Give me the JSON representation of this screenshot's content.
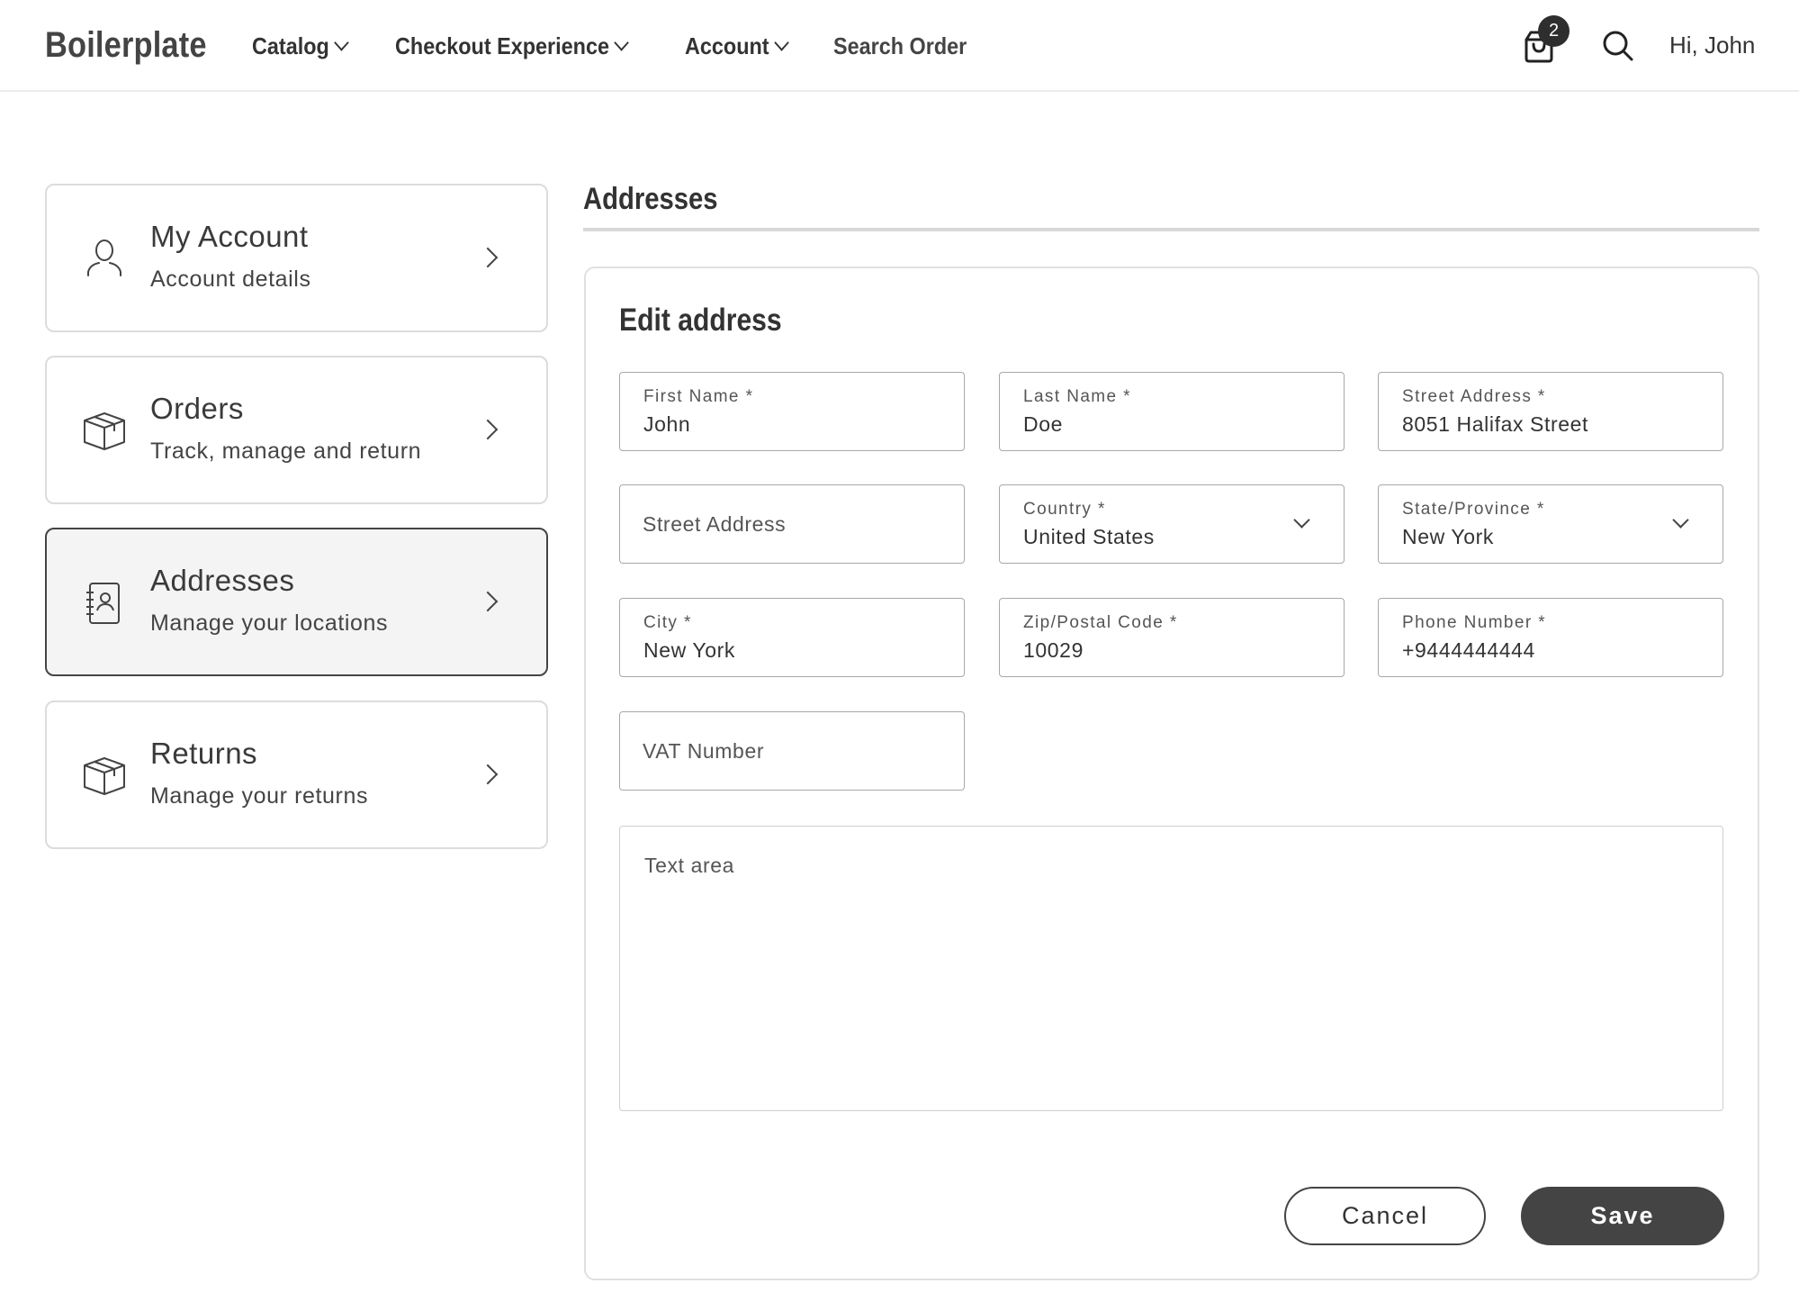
{
  "header": {
    "logo": "Boilerplate",
    "nav": [
      {
        "label": "Catalog",
        "has_dropdown": true
      },
      {
        "label": "Checkout Experience",
        "has_dropdown": true
      },
      {
        "label": "Account",
        "has_dropdown": true
      },
      {
        "label": "Search Order",
        "has_dropdown": false
      }
    ],
    "cart_icon": "shopping-bag-icon",
    "cart_count": "2",
    "search_icon": "search-icon",
    "greeting": "Hi, John"
  },
  "sidebar": {
    "items": [
      {
        "title": "My Account",
        "subtitle": "Account details",
        "icon": "user-icon",
        "active": false
      },
      {
        "title": "Orders",
        "subtitle": "Track, manage and return",
        "icon": "box-icon",
        "active": false
      },
      {
        "title": "Addresses",
        "subtitle": "Manage your locations",
        "icon": "address-book-icon",
        "active": true
      },
      {
        "title": "Returns",
        "subtitle": "Manage your returns",
        "icon": "box-icon",
        "active": false
      }
    ]
  },
  "main": {
    "page_title": "Addresses",
    "form": {
      "title": "Edit address",
      "fields": {
        "first_name": {
          "label": "First Name *",
          "value": "John"
        },
        "last_name": {
          "label": "Last Name *",
          "value": "Doe"
        },
        "street_address": {
          "label": "Street Address *",
          "value": "8051 Halifax Street"
        },
        "street_address_2": {
          "placeholder": "Street Address",
          "value": ""
        },
        "country": {
          "label": "Country *",
          "value": "United States"
        },
        "state": {
          "label": "State/Province *",
          "value": "New York"
        },
        "city": {
          "label": "City *",
          "value": "New York"
        },
        "zip": {
          "label": "Zip/Postal Code *",
          "value": "10029"
        },
        "phone": {
          "label": "Phone Number *",
          "value": "+9444444444"
        },
        "vat": {
          "placeholder": "VAT Number",
          "value": ""
        },
        "notes": {
          "placeholder": "Text area",
          "value": ""
        }
      },
      "cancel_label": "Cancel",
      "save_label": "Save"
    }
  },
  "colors": {
    "primary_dark": "#444444",
    "active_card_bg": "#f4f4f4",
    "border_light": "#dcdcdc",
    "badge_bg": "#2e2e2e"
  }
}
